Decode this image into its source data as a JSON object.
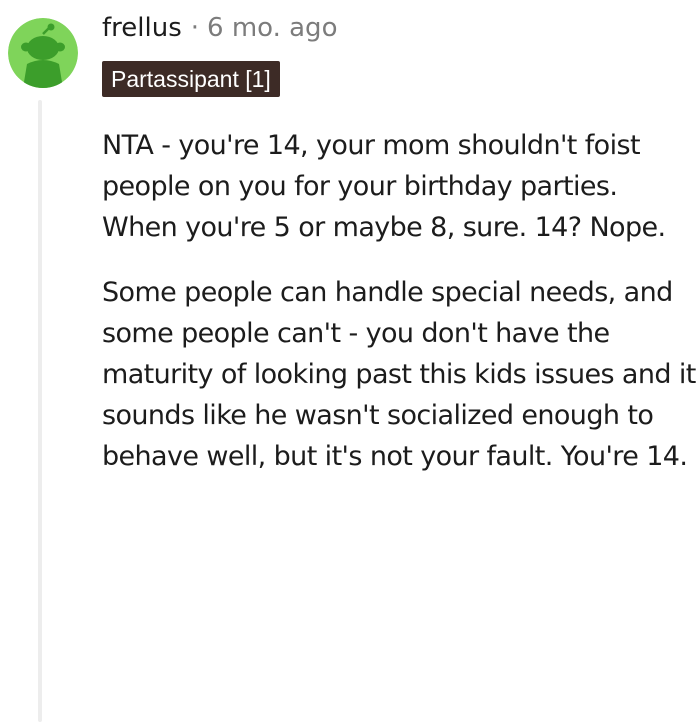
{
  "comment": {
    "author": "frellus",
    "separator": "·",
    "timestamp": "6 mo. ago",
    "flair": "Partassipant [1]",
    "avatar_icon": "snoo-avatar-icon",
    "paragraphs": [
      "NTA - you're 14, your mom shouldn't foist people on you for your birthday parties. When you're 5 or maybe 8, sure. 14? Nope.",
      "Some people can handle special needs, and some people can't - you don't have the maturity of looking past this kids issues and it sounds like he wasn't socialized enough to behave well, but it's not your fault. You're 14."
    ]
  },
  "colors": {
    "avatar_background": "#7fd45a",
    "avatar_figure": "#3c9e2b",
    "flair_background": "#3d2b26",
    "flair_text": "#ffffff",
    "muted_text": "#7c7c7c",
    "body_text": "#1c1c1c",
    "thread_line": "#ededed"
  }
}
